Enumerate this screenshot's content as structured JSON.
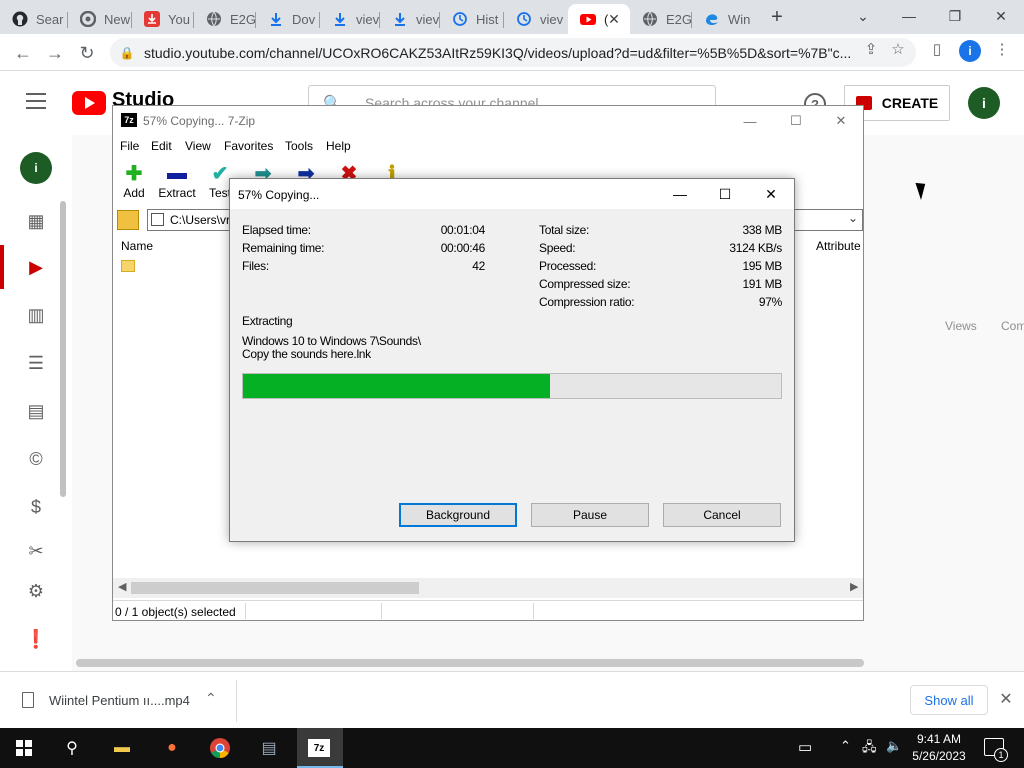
{
  "browser": {
    "tabs": [
      {
        "label": "Sear",
        "icon": "github-icon"
      },
      {
        "label": "New",
        "icon": "chrome-icon"
      },
      {
        "label": "You",
        "icon": "download-red-icon"
      },
      {
        "label": "E2G",
        "icon": "globe-icon"
      },
      {
        "label": "Dov",
        "icon": "download-icon"
      },
      {
        "label": "viev",
        "icon": "download-icon"
      },
      {
        "label": "viev",
        "icon": "download-icon"
      },
      {
        "label": "Hist",
        "icon": "history-icon"
      },
      {
        "label": "viev",
        "icon": "history-icon"
      },
      {
        "label": "(",
        "icon": "youtube-icon"
      },
      {
        "label": "E2G",
        "icon": "globe-icon"
      },
      {
        "label": "Win",
        "icon": "edge-icon"
      }
    ],
    "active_tab_index": 9,
    "url": "studio.youtube.com/channel/UCOxRO6CAKZ53AItRz59KI3Q/videos/upload?d=ud&filter=%5B%5D&sort=%7B\"c...",
    "profile_initial": "i"
  },
  "studio": {
    "logo_text": "Studio",
    "search_placeholder": "Search across your channel",
    "create_label": "CREATE",
    "avatar_initial": "i",
    "columns": [
      "Views",
      "Com"
    ]
  },
  "zip": {
    "title": "57% Copying... 7-Zip",
    "icon_text": "7z",
    "menu": [
      "File",
      "Edit",
      "View",
      "Favorites",
      "Tools",
      "Help"
    ],
    "toolbar": [
      {
        "label": "Add",
        "icon": "add-icon",
        "color": "#20b020"
      },
      {
        "label": "Extract",
        "icon": "extract-icon",
        "color": "#1020a0"
      },
      {
        "label": "Test",
        "icon": "test-icon",
        "color": "#20b0a0"
      },
      {
        "label": "",
        "icon": "copy-icon",
        "color": "#209090"
      },
      {
        "label": "",
        "icon": "move-icon",
        "color": "#1030a0"
      },
      {
        "label": "",
        "icon": "delete-icon",
        "color": "#d01010"
      },
      {
        "label": "",
        "icon": "info-icon",
        "color": "#c0a000"
      }
    ],
    "path": "C:\\Users\\vr",
    "list_header_name": "Name",
    "list_header_attr": "Attribute",
    "status": "0 / 1 object(s) selected"
  },
  "dialog": {
    "title": "57% Copying...",
    "elapsed_label": "Elapsed time:",
    "elapsed_value": "00:01:04",
    "remaining_label": "Remaining time:",
    "remaining_value": "00:00:46",
    "files_label": "Files:",
    "files_value": "42",
    "total_size_label": "Total size:",
    "total_size_value": "338 MB",
    "speed_label": "Speed:",
    "speed_value": "3124 KB/s",
    "processed_label": "Processed:",
    "processed_value": "195 MB",
    "compressed_label": "Compressed size:",
    "compressed_value": "191 MB",
    "ratio_label": "Compression ratio:",
    "ratio_value": "97%",
    "operation": "Extracting",
    "current_path": "Windows 10 to Windows 7\\Sounds\\",
    "current_file": "Copy the sounds here.lnk",
    "progress_percent": 57,
    "progress_color": "#06b025",
    "buttons": {
      "background": "Background",
      "pause": "Pause",
      "cancel": "Cancel"
    }
  },
  "downloads": {
    "file_name": "Wiintel Pentium ıı....mp4",
    "show_all": "Show all"
  },
  "taskbar": {
    "time": "9:41 AM",
    "date": "5/26/2023",
    "notification_count": "1"
  }
}
